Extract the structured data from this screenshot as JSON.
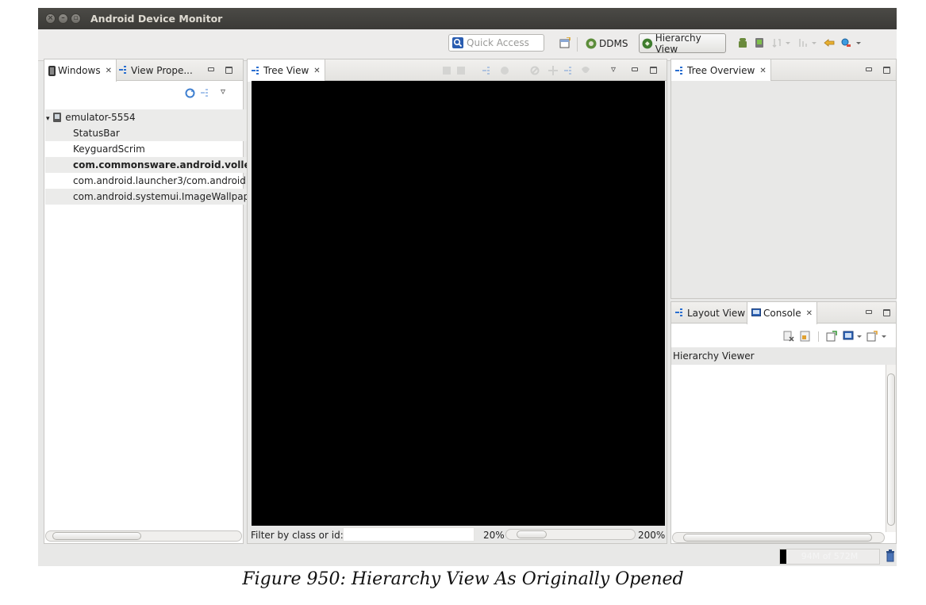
{
  "window": {
    "title": "Android Device Monitor",
    "close_glyph": "×",
    "min_glyph": "–",
    "max_glyph": "▫"
  },
  "toolbar": {
    "quick_access_placeholder": "Quick Access",
    "perspective_ddms": "DDMS",
    "perspective_hierarchy": "Hierarchy View"
  },
  "windows_panel": {
    "tabs": [
      {
        "label": "Windows",
        "close": "✕"
      },
      {
        "label": "View Prope...",
        "close": ""
      }
    ],
    "device": "emulator-5554",
    "expand_glyph": "▾",
    "menu_glyph": "▿",
    "items": [
      {
        "label": "StatusBar"
      },
      {
        "label": "KeyguardScrim"
      },
      {
        "label": "com.commonsware.android.volley/c"
      },
      {
        "label": "com.android.launcher3/com.android"
      },
      {
        "label": "com.android.systemui.ImageWallpap"
      }
    ]
  },
  "tree_view": {
    "tab_label": "Tree View",
    "close": "✕",
    "menu_glyph": "▿",
    "filter_label": "Filter by class or id:",
    "filter_value": "",
    "zoom_min": "20%",
    "zoom_max": "200%",
    "zoom_level": 0.0
  },
  "tree_overview": {
    "tab_label": "Tree Overview",
    "close": "✕"
  },
  "bottom_right": {
    "tabs": [
      {
        "label": "Layout View",
        "close": ""
      },
      {
        "label": "Console",
        "close": "✕"
      }
    ],
    "console_title": "Hierarchy Viewer"
  },
  "status": {
    "heap_text": "94M of 572M",
    "heap_used_fraction": 0.06
  },
  "caption": "Figure 950: Hierarchy View As Originally Opened",
  "colors": {
    "title_bar": "#3c3b37",
    "canvas": "#000000",
    "selected_row": "#ebebea",
    "tree_blue": "#2b6fd0"
  }
}
